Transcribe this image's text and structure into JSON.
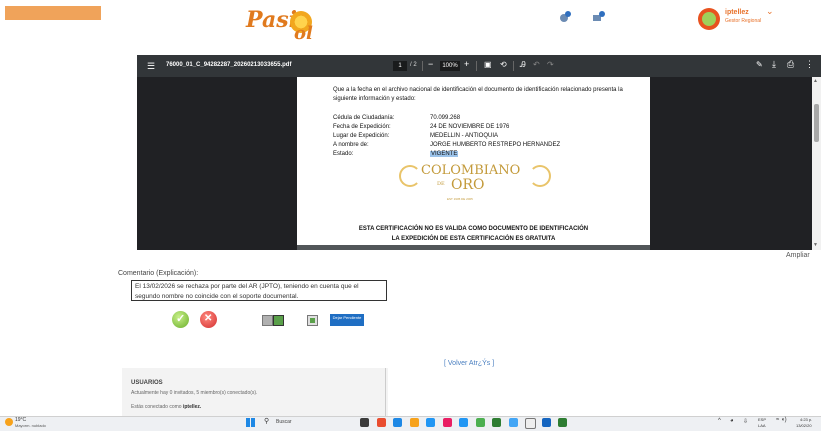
{
  "header": {
    "logo_text_1": "Pasiv",
    "logo_text_2": "ol",
    "user_name": "iptellez",
    "user_role": "Gestor Regional"
  },
  "pdf": {
    "filename": "76000_01_C_94282287_20260213033655.pdf",
    "page_current": "1",
    "page_total": "/ 2",
    "zoom": "100%",
    "zoom_out": "−",
    "zoom_in": "+",
    "intro": "Que a la fecha en el archivo nacional de identificación el documento de identificación relacionado presenta la siguiente información y estado:",
    "fields": [
      {
        "label": "Cédula de Ciudadanía:",
        "value": "70.099.268"
      },
      {
        "label": "Fecha de Expedición:",
        "value": "24 DE NOVIEMBRE DE 1976"
      },
      {
        "label": "Lugar de Expedición:",
        "value": "MEDELLIN - ANTIOQUIA"
      },
      {
        "label": "A nombre de:",
        "value": "JORGE HUMBERTO RESTREPO HERNANDEZ"
      },
      {
        "label": "Estado:",
        "value": "VIGENTE"
      }
    ],
    "seal": {
      "name": "COLOMBIANO",
      "di": "DE",
      "oro": "ORO",
      "year": "EST 1905 DE 2005"
    },
    "warning_1": "ESTA CERTIFICACIÓN NO ES VALIDA COMO DOCUMENTO DE IDENTIFICACIÓN",
    "warning_2": "LA EXPEDICIÓN DE ESTA CERTIFICACIÓN ES GRATUITA"
  },
  "ampliar": "Ampliar",
  "comment": {
    "label": "Comentario (Explicación):",
    "text": "El 13/02/2026 se rechaza por parte del AR (JPTO), teniendo en cuenta que el segundo nombre no coincide con el soporte documental."
  },
  "actions": {
    "pending_label": "Dejar Pendiente"
  },
  "volver": "[ Volver Atr¿Ýs ]",
  "users": {
    "title": "USUARIOS",
    "line1": "Actualmente hay 0 invitados, 5 miembro(s) conectado(s).",
    "line2_prefix": "Estás conectado como",
    "line2_user": "iptellez."
  },
  "taskbar": {
    "weather_temp": "19°C",
    "weather_desc": "Mayorm. nublado",
    "search_text": "Buscar",
    "lang_1": "ESP",
    "lang_2": "LAA",
    "time": "4:23 p.",
    "date": "13/02/20",
    "app_colors": [
      "#3b3b3b",
      "#e94d2f",
      "#1e88e5",
      "#f7a21b",
      "#2196f3",
      "#e91e63",
      "#2196f3",
      "#4caf50",
      "#2e7d32",
      "#42a5f5",
      "#eeeeee",
      "#1565c0",
      "#2e7d32"
    ]
  }
}
